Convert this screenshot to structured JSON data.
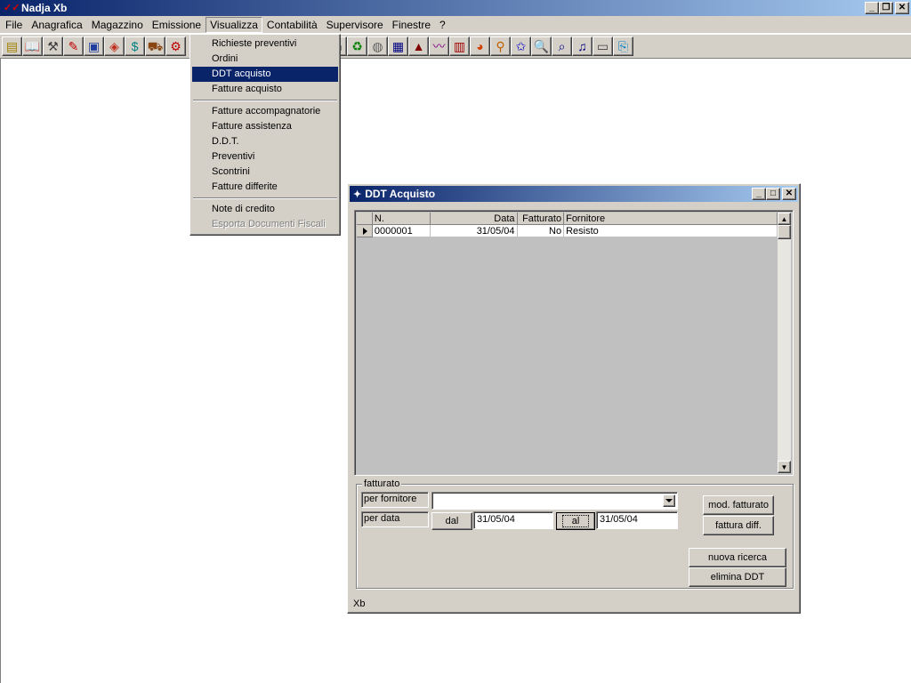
{
  "app": {
    "title": "Nadja Xb",
    "window_buttons": [
      "_",
      "❐",
      "✕"
    ]
  },
  "menubar": [
    {
      "label": "File"
    },
    {
      "label": "Anagrafica"
    },
    {
      "label": "Magazzino"
    },
    {
      "label": "Emissione"
    },
    {
      "label": "Visualizza"
    },
    {
      "label": "Contabilità"
    },
    {
      "label": "Supervisore"
    },
    {
      "label": "Finestre"
    },
    {
      "label": "?"
    }
  ],
  "toolbar": {
    "icons": [
      "notes-icon",
      "book-icon",
      "hammer-icon",
      "pencil-icon",
      "package-icon",
      "box-icon",
      "money-icon",
      "truck-icon",
      "bike-icon",
      "blank1",
      "blank2",
      "blank3",
      "blank4",
      "blank5",
      "blank6",
      "blank7",
      "printer-icon",
      "recycle-icon",
      "disk-icon",
      "chart-icon",
      "factory-icon",
      "trend-icon",
      "graph-icon",
      "pie-icon",
      "user-search-icon",
      "star-icon",
      "zoom-icon",
      "search-doc-icon",
      "music-icon",
      "folders-icon",
      "printer-color-icon"
    ]
  },
  "dropdown": {
    "items": [
      {
        "label": "Richieste preventivi",
        "state": "normal"
      },
      {
        "label": "Ordini",
        "state": "normal"
      },
      {
        "label": "DDT acquisto",
        "state": "selected"
      },
      {
        "label": "Fatture acquisto",
        "state": "normal"
      },
      {
        "sep": true
      },
      {
        "label": "Fatture accompagnatorie",
        "state": "normal"
      },
      {
        "label": "Fatture assistenza",
        "state": "normal"
      },
      {
        "label": "D.D.T.",
        "state": "normal"
      },
      {
        "label": "Preventivi",
        "state": "normal"
      },
      {
        "label": "Scontrini",
        "state": "normal"
      },
      {
        "label": "Fatture differite",
        "state": "normal"
      },
      {
        "sep": true
      },
      {
        "label": "Note di credito",
        "state": "normal"
      },
      {
        "label": "Esporta Documenti Fiscali",
        "state": "disabled"
      }
    ]
  },
  "child": {
    "title": "DDT Acquisto",
    "grid": {
      "columns": [
        "N.",
        "Data",
        "Fatturato",
        "Fornitore"
      ],
      "rows": [
        {
          "n": "0000001",
          "data": "31/05/04",
          "fatturato": "No",
          "fornitore": "Resisto"
        }
      ]
    },
    "groupbox": {
      "legend": "fatturato",
      "per_fornitore_label": "per fornitore",
      "fornitore_value": "",
      "per_data_label": "per data",
      "dal_button": "dal",
      "dal_value": "31/05/04",
      "al_button": "al",
      "al_value": "31/05/04"
    },
    "buttons": {
      "mod_fatturato": "mod. fatturato",
      "fattura_diff": "fattura diff.",
      "nuova_ricerca": "nuova ricerca",
      "elimina_ddt": "elimina DDT"
    },
    "status": "Xb"
  }
}
